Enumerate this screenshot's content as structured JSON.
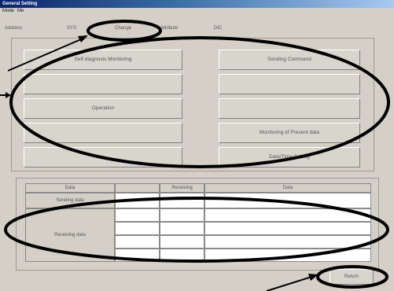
{
  "window": {
    "title": "General Setting"
  },
  "menu": [
    "Mode",
    "Me"
  ],
  "tabs": [
    "Address",
    "SYS",
    "Change",
    "Attribute",
    "DIC"
  ],
  "buttons": {
    "self_diagnosis_monitoring": "Self-diagnosis Monitoring",
    "sending_command": "Sending Command",
    "operation": "Operation",
    "monitoring_of_present_data": "Monitoring of Present data",
    "date_time_setting": "Date/Time Setting"
  },
  "table": {
    "headers": [
      "Data",
      "",
      "Receiving",
      "Data"
    ],
    "row_labels": [
      "Sending data",
      "Receiving data"
    ]
  },
  "return_button": "Return",
  "colors": {
    "annotation": "#000000",
    "window_bg": "#d4d0c8",
    "titlebar": "#0a246a"
  }
}
